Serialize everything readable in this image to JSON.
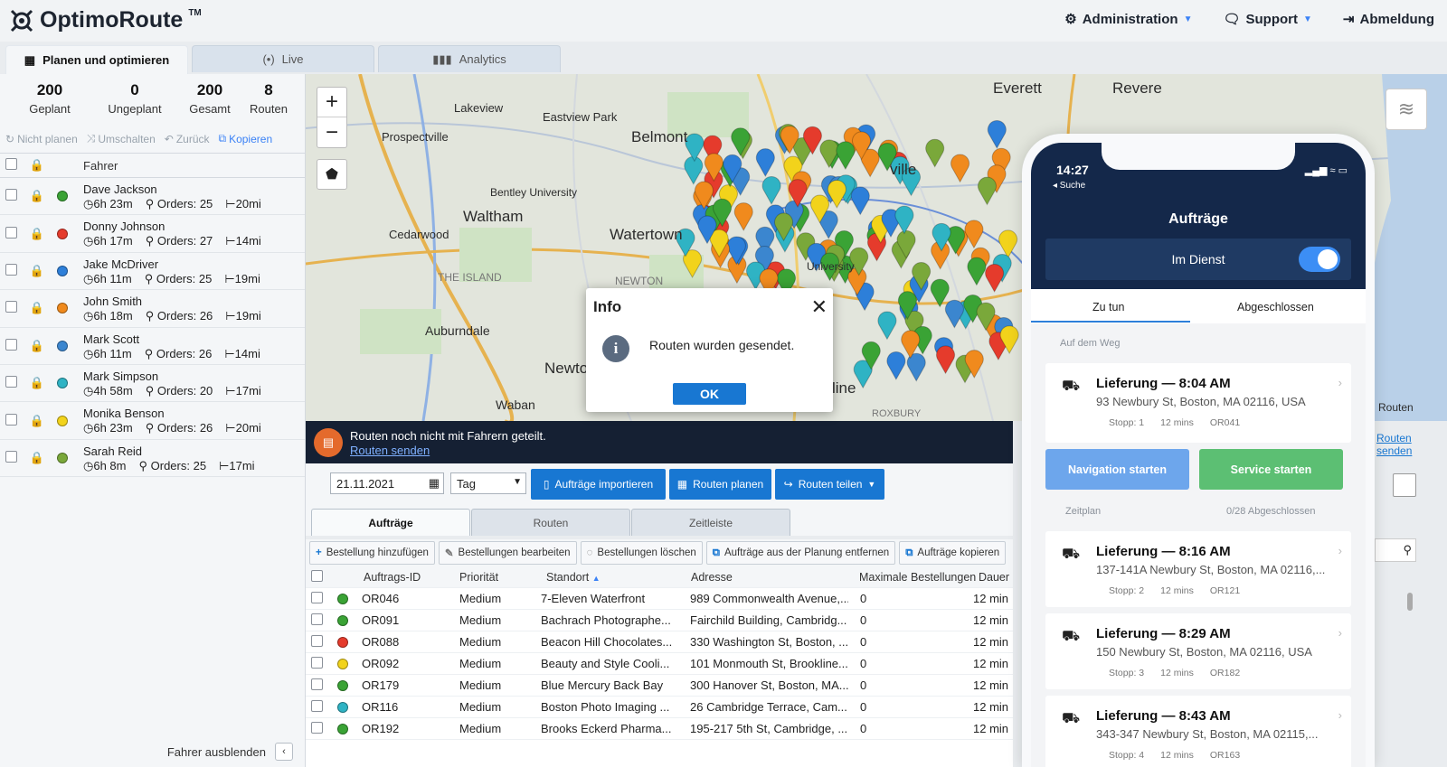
{
  "app": {
    "logo": "OptimoRoute",
    "tm": "TM"
  },
  "topnav": {
    "admin": "Administration",
    "support": "Support",
    "logout": "Abmeldung"
  },
  "tabs": [
    "Planen und optimieren",
    "Live",
    "Analytics"
  ],
  "stats": [
    {
      "value": "200",
      "label": "Geplant"
    },
    {
      "value": "0",
      "label": "Ungeplant"
    },
    {
      "value": "200",
      "label": "Gesamt"
    },
    {
      "value": "8",
      "label": "Routen"
    }
  ],
  "left_actions": [
    "Nicht planen",
    "Umschalten",
    "Zurück",
    "Kopieren"
  ],
  "drivers_header": "Fahrer",
  "drivers": [
    {
      "name": "Dave Jackson",
      "time": "6h 23m",
      "orders": "Orders: 25",
      "dist": "20mi",
      "color": "#3aa335"
    },
    {
      "name": "Donny Johnson",
      "time": "6h 17m",
      "orders": "Orders: 27",
      "dist": "14mi",
      "color": "#e53b2c"
    },
    {
      "name": "Jake McDriver",
      "time": "6h 11m",
      "orders": "Orders: 25",
      "dist": "19mi",
      "color": "#2d7fd9"
    },
    {
      "name": "John Smith",
      "time": "6h 18m",
      "orders": "Orders: 26",
      "dist": "19mi",
      "color": "#f08a1d"
    },
    {
      "name": "Mark Scott",
      "time": "6h 11m",
      "orders": "Orders: 26",
      "dist": "14mi",
      "color": "#3b86cf"
    },
    {
      "name": "Mark Simpson",
      "time": "4h 58m",
      "orders": "Orders: 20",
      "dist": "17mi",
      "color": "#2fb3c4"
    },
    {
      "name": "Monika Benson",
      "time": "6h 23m",
      "orders": "Orders: 26",
      "dist": "20mi",
      "color": "#f2d31b"
    },
    {
      "name": "Sarah Reid",
      "time": "6h 8m",
      "orders": "Orders: 25",
      "dist": "17mi",
      "color": "#7aa83a"
    }
  ],
  "hide_drivers": "Fahrer ausblenden",
  "map_labels": [
    "Everett",
    "Revere",
    "Lakeview",
    "Eastview Park",
    "Prospectville",
    "Belmont",
    "Bentley University",
    "Waltham",
    "Cedarwood",
    "Watertown",
    "THE ISLAND",
    "NEWTON",
    "Auburndale",
    "Newton",
    "Waban",
    "University",
    "line",
    "ville",
    "ROXBURY",
    "Routen"
  ],
  "notice": {
    "text": "Routen noch nicht mit Fahrern geteilt.",
    "link": "Routen senden"
  },
  "toolbar": {
    "date": "21.11.2021",
    "period": "Tag",
    "import": "Aufträge importieren",
    "plan": "Routen planen",
    "share": "Routen teilen"
  },
  "bottom_tabs": [
    "Aufträge",
    "Routen",
    "Zeitleiste"
  ],
  "order_actions": [
    "Bestellung hinzufügen",
    "Bestellungen bearbeiten",
    "Bestellungen löschen",
    "Aufträge aus der Planung entfernen",
    "Aufträge kopieren"
  ],
  "table": {
    "headers": [
      "Auftrags-ID",
      "Priorität",
      "Standort",
      "Adresse",
      "Maximale Bestellungen",
      "Dauer"
    ],
    "rows": [
      {
        "color": "#3aa335",
        "id": "OR046",
        "prio": "Medium",
        "loc": "7-Eleven Waterfront",
        "addr": "989 Commonwealth Avenue,...",
        "max": "0",
        "dur": "12 min"
      },
      {
        "color": "#3aa335",
        "id": "OR091",
        "prio": "Medium",
        "loc": "Bachrach Photographe...",
        "addr": "Fairchild Building, Cambridg...",
        "max": "0",
        "dur": "12 min"
      },
      {
        "color": "#e53b2c",
        "id": "OR088",
        "prio": "Medium",
        "loc": "Beacon Hill Chocolates...",
        "addr": "330 Washington St, Boston, ...",
        "max": "0",
        "dur": "12 min"
      },
      {
        "color": "#f2d31b",
        "id": "OR092",
        "prio": "Medium",
        "loc": "Beauty and Style Cooli...",
        "addr": "101 Monmouth St, Brookline...",
        "max": "0",
        "dur": "12 min"
      },
      {
        "color": "#3aa335",
        "id": "OR179",
        "prio": "Medium",
        "loc": "Blue Mercury Back Bay",
        "addr": "300 Hanover St, Boston, MA...",
        "max": "0",
        "dur": "12 min"
      },
      {
        "color": "#2fb3c4",
        "id": "OR116",
        "prio": "Medium",
        "loc": "Boston Photo Imaging ...",
        "addr": "26 Cambridge Terrace, Cam...",
        "max": "0",
        "dur": "12 min"
      },
      {
        "color": "#3aa335",
        "id": "OR192",
        "prio": "Medium",
        "loc": "Brooks Eckerd Pharma...",
        "addr": "195-217 5th St, Cambridge, ...",
        "max": "0",
        "dur": "12 min"
      }
    ]
  },
  "modal": {
    "title": "Info",
    "message": "Routen wurden gesendet.",
    "ok": "OK"
  },
  "phone": {
    "time": "14:27",
    "back": "◂ Suche",
    "title": "Aufträge",
    "duty": "Im Dienst",
    "tab_todo": "Zu tun",
    "tab_done": "Abgeschlossen",
    "section_way": "Auf dem Weg",
    "nav": "Navigation starten",
    "service": "Service starten",
    "schedule": "Zeitplan",
    "schedule_count": "0/28 Abgeschlossen",
    "cards": [
      {
        "title": "Lieferung — 8:04 AM",
        "addr": "93 Newbury St, Boston, MA 02116, USA",
        "stop": "Stopp: 1",
        "mins": "12 mins",
        "id": "OR041"
      },
      {
        "title": "Lieferung — 8:16 AM",
        "addr": "137-141A Newbury St, Boston, MA 02116,...",
        "stop": "Stopp: 2",
        "mins": "12 mins",
        "id": "OR121"
      },
      {
        "title": "Lieferung — 8:29 AM",
        "addr": "150 Newbury St, Boston, MA 02116, USA",
        "stop": "Stopp: 3",
        "mins": "12 mins",
        "id": "OR182"
      },
      {
        "title": "Lieferung — 8:43 AM",
        "addr": "343-347 Newbury St, Boston, MA 02115,...",
        "stop": "Stopp: 4",
        "mins": "12 mins",
        "id": "OR163"
      }
    ]
  },
  "right_panel": {
    "routen": "Routen",
    "link1": "Routen",
    "link2": "senden"
  }
}
